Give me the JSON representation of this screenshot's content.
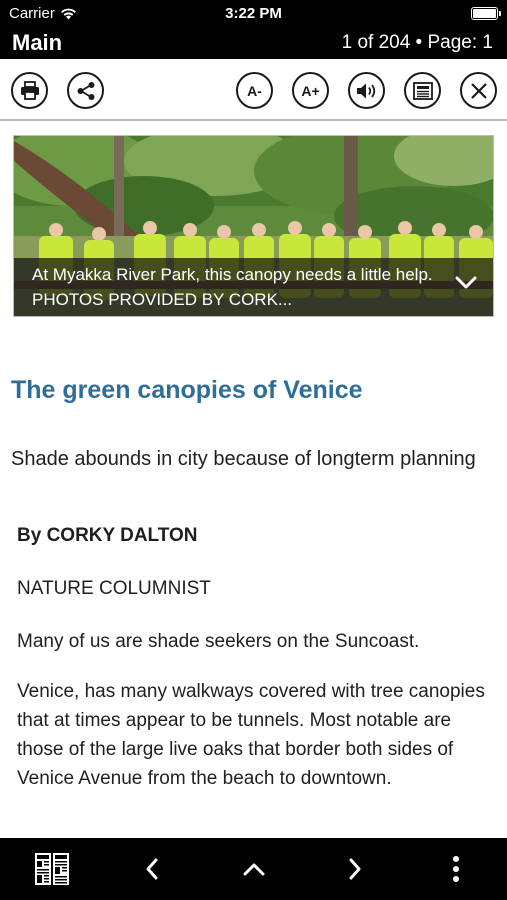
{
  "status_bar": {
    "carrier": "Carrier",
    "time": "3:22 PM",
    "wifi_icon": "wifi-icon",
    "battery_icon": "battery-full-icon"
  },
  "nav_bar": {
    "title": "Main",
    "page_info": "1 of 204 • Page: 1"
  },
  "toolbar": {
    "buttons": [
      {
        "icon": "print-icon"
      },
      {
        "icon": "share-icon"
      },
      {
        "icon": "font-decrease-icon",
        "label": "A-"
      },
      {
        "icon": "font-increase-icon",
        "label": "A+"
      },
      {
        "icon": "speaker-icon"
      },
      {
        "icon": "article-view-icon"
      },
      {
        "icon": "close-icon"
      }
    ]
  },
  "hero": {
    "caption": "At Myakka River Park, this canopy needs a little help.  PHOTOS PROVIDED BY CORK...",
    "expand_icon": "chevron-down-icon"
  },
  "article": {
    "headline": "The green canopies of Venice",
    "subhead": "Shade abounds in city because of longterm planning",
    "byline": "By CORKY DALTON",
    "byline_title": "NATURE COLUMNIST",
    "paragraphs": [
      "Many of us are shade seekers on the Suncoast.",
      "Venice, has many walkways covered with tree canopies that at times appear to be tunnels. Most notable are those of the large live oaks that border both sides of Venice Avenue from the beach to downtown."
    ]
  },
  "bottom_bar": {
    "buttons": [
      {
        "icon": "newspaper-pages-icon"
      },
      {
        "icon": "chevron-left-icon"
      },
      {
        "icon": "chevron-up-icon"
      },
      {
        "icon": "chevron-right-icon"
      },
      {
        "icon": "more-vertical-icon"
      }
    ]
  },
  "colors": {
    "headline": "#2e6e98",
    "bars": "#000000",
    "text": "#1f1f1f"
  }
}
